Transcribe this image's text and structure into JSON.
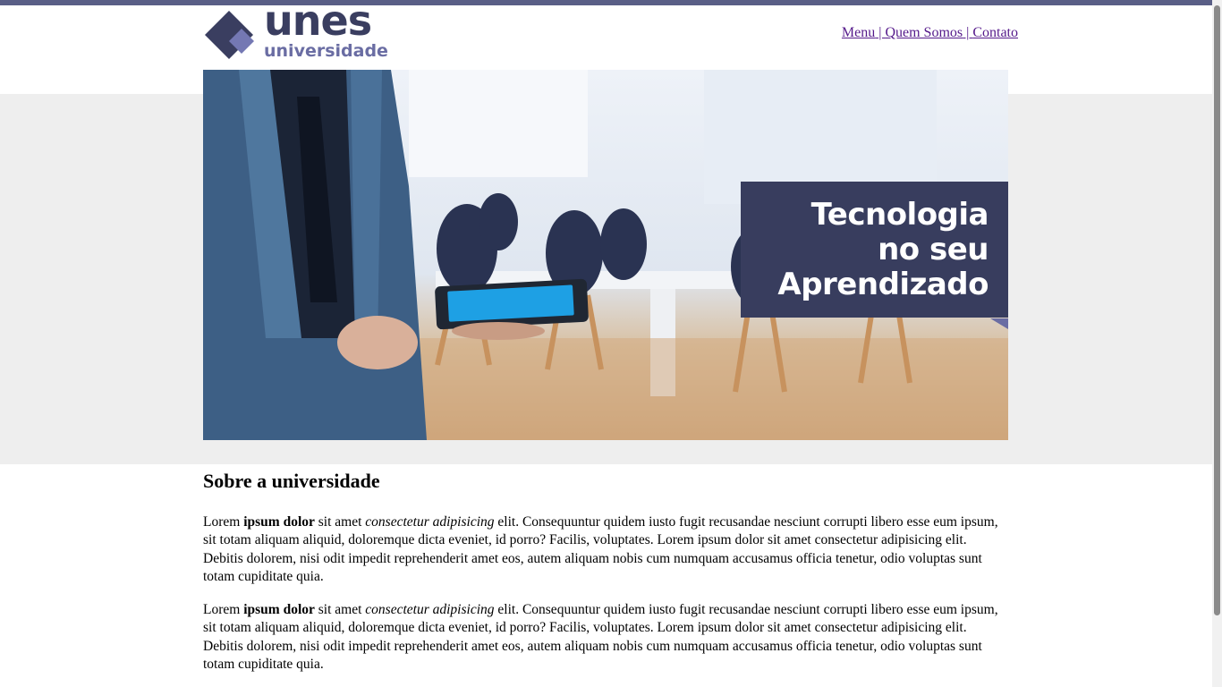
{
  "header": {
    "logo_word": "unes",
    "logo_sub": "universidade",
    "nav": [
      {
        "label": "Menu"
      },
      {
        "label": "Quem Somos"
      },
      {
        "label": "Contato"
      }
    ],
    "nav_separator": " | "
  },
  "hero": {
    "lines": [
      "Tecnologia",
      "no seu",
      "Aprendizado"
    ]
  },
  "about": {
    "title": "Sobre a universidade",
    "paragraphs": [
      {
        "w1": "Lorem ",
        "bold": "ipsum dolor",
        "w2": " sit amet ",
        "italic": "consectetur adipisicing",
        "rest": " elit. Consequuntur quidem iusto fugit recusandae nesciunt corrupti libero esse eum ipsum, sit totam aliquam aliquid, doloremque dicta eveniet, id porro? Facilis, voluptates. Lorem ipsum dolor sit amet consectetur adipisicing elit. Debitis dolorem, nisi odit impedit reprehenderit amet eos, autem aliquam nobis cum numquam accusamus officia tenetur, odio voluptas sunt totam cupiditate quia."
      },
      {
        "w1": "Lorem ",
        "bold": "ipsum dolor",
        "w2": " sit amet ",
        "italic": "consectetur adipisicing",
        "rest": " elit. Consequuntur quidem iusto fugit recusandae nesciunt corrupti libero esse eum ipsum, sit totam aliquam aliquid, doloremque dicta eveniet, id porro? Facilis, voluptates. Lorem ipsum dolor sit amet consectetur adipisicing elit. Debitis dolorem, nisi odit impedit reprehenderit amet eos, autem aliquam nobis cum numquam accusamus officia tenetur, odio voluptas sunt totam cupiditate quia."
      }
    ]
  },
  "colors": {
    "brand_dark": "#3a3e60",
    "brand_light": "#6a6da3",
    "link_visited": "#551a8b",
    "band_gray": "#eeeeee"
  },
  "icons": {
    "logo_mark": "diamond-logo-icon"
  }
}
